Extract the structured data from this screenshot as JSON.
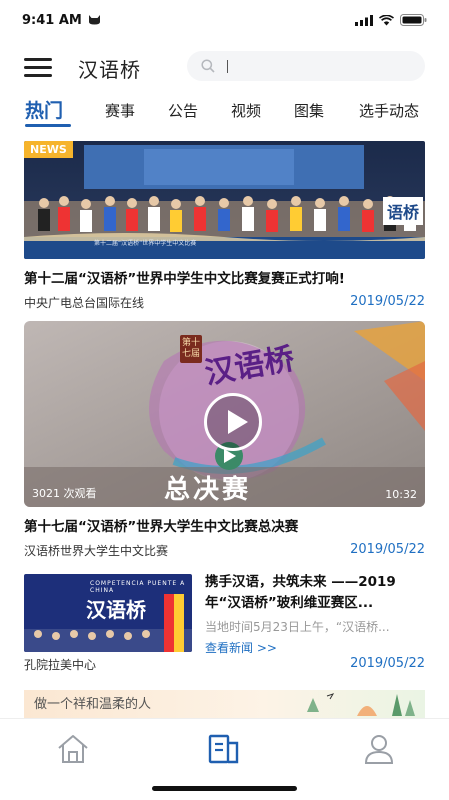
{
  "status": {
    "time": "9:41 AM"
  },
  "header": {
    "title": "汉语桥",
    "search_placeholder": ""
  },
  "tabs": [
    {
      "label": "热门",
      "active": true
    },
    {
      "label": "赛事"
    },
    {
      "label": "公告"
    },
    {
      "label": "视频"
    },
    {
      "label": "图集"
    },
    {
      "label": "选手动态"
    }
  ],
  "news": [
    {
      "badge": "NEWS",
      "title": "第十二届“汉语桥”世界中学生中文比赛复赛正式打响!",
      "source": "中央广电总台国际在线",
      "date": "2019/05/22",
      "image_caption": "第十二届“汉语桥”世界中学生中文比赛",
      "image_logo": "语桥"
    },
    {
      "title": "第十七届“汉语桥”世界大学生中文比赛总决赛",
      "source": "汉语桥世界大学生中文比赛",
      "date": "2019/05/22",
      "views": "3021 次观看",
      "duration": "10:32",
      "image_text": "总决赛",
      "image_logo": "汉语桥",
      "image_seal": "第十七届"
    },
    {
      "title": "携手汉语，共筑未来 ——2019年“汉语桥”玻利维亚赛区...",
      "desc": "当地时间5月23日上午，“汉语桥...",
      "link": "查看新闻 >>",
      "source": "孔院拉美中心",
      "date": "2019/05/22",
      "image_logo": "汉语桥",
      "image_banner": "COMPETENCIA PUENTE A CHINA"
    }
  ],
  "ad": {
    "text": "做一个祥和温柔的人"
  },
  "colors": {
    "accent": "#1f5fb0",
    "date": "#1f6fc2",
    "badge": "#f6b42c"
  },
  "nav": [
    {
      "icon": "home-icon",
      "active": false
    },
    {
      "icon": "news-icon",
      "active": true
    },
    {
      "icon": "profile-icon",
      "active": false
    }
  ]
}
